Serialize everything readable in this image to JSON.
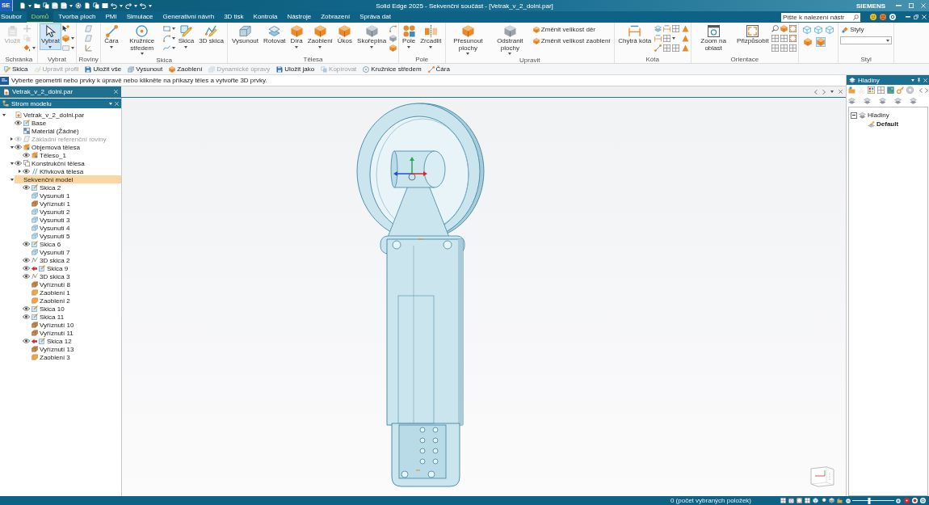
{
  "title_bar": {
    "app_badge": "SE",
    "title": "Solid Edge 2025 - Sekvenční součást - [Vetrak_v_2_dolni.par]",
    "brand": "SIEMENS"
  },
  "menu_tabs": [
    {
      "label": "Soubor",
      "selected": false
    },
    {
      "label": "Domů",
      "selected": true
    },
    {
      "label": "Tvorba ploch",
      "selected": false
    },
    {
      "label": "PMI",
      "selected": false
    },
    {
      "label": "Simulace",
      "selected": false
    },
    {
      "label": "Generativní návrh",
      "selected": false
    },
    {
      "label": "3D tisk",
      "selected": false
    },
    {
      "label": "Kontrola",
      "selected": false
    },
    {
      "label": "Nástroje",
      "selected": false
    },
    {
      "label": "Zobrazení",
      "selected": false
    },
    {
      "label": "Správa dat",
      "selected": false
    }
  ],
  "search": {
    "placeholder": "Pište k nalezení nástr"
  },
  "ribbon": {
    "groups": [
      {
        "label": "Schránka",
        "buttons": [
          {
            "kind": "large",
            "label": "Vložit",
            "disabled": true,
            "active": false,
            "dropdown": false
          }
        ]
      },
      {
        "label": "Vybrat",
        "buttons": [
          {
            "kind": "large",
            "label": "Vybrat",
            "disabled": false,
            "active": true,
            "dropdown": true
          }
        ]
      },
      {
        "label": "Roviny"
      },
      {
        "label": "Skica",
        "buttons": [
          {
            "kind": "large",
            "label": "Čára",
            "disabled": false,
            "active": false,
            "dropdown": true
          },
          {
            "kind": "large",
            "label": "Kružnice středem",
            "disabled": false,
            "active": false,
            "dropdown": true
          },
          {
            "kind": "large",
            "label": "Skica",
            "disabled": false,
            "active": false,
            "dropdown": true
          },
          {
            "kind": "large",
            "label": "3D skica",
            "disabled": false,
            "active": false,
            "dropdown": false
          }
        ]
      },
      {
        "label": "Tělesa",
        "buttons": [
          {
            "kind": "large",
            "label": "Vysunout",
            "disabled": false,
            "active": false,
            "dropdown": false
          },
          {
            "kind": "large",
            "label": "Rotovat",
            "disabled": false,
            "active": false,
            "dropdown": false
          },
          {
            "kind": "large",
            "label": "Díra",
            "disabled": false,
            "active": false,
            "dropdown": true
          },
          {
            "kind": "large",
            "label": "Zaoblení",
            "disabled": false,
            "active": false,
            "dropdown": true
          },
          {
            "kind": "large",
            "label": "Úkos",
            "disabled": false,
            "active": false,
            "dropdown": false
          },
          {
            "kind": "large",
            "label": "Skořepina",
            "disabled": false,
            "active": false,
            "dropdown": true
          }
        ]
      },
      {
        "label": "Pole",
        "buttons": [
          {
            "kind": "large",
            "label": "Pole",
            "disabled": false,
            "active": false,
            "dropdown": true
          },
          {
            "kind": "large",
            "label": "Zrcadlit",
            "disabled": false,
            "active": false,
            "dropdown": true
          }
        ]
      },
      {
        "label": "Upravit",
        "buttons": [
          {
            "kind": "large",
            "label": "Přesunout plochy",
            "disabled": false,
            "active": false,
            "dropdown": true
          },
          {
            "kind": "large",
            "label": "Odstranit plochy",
            "disabled": false,
            "active": false,
            "dropdown": true
          },
          {
            "kind": "small",
            "label": "Změnit velikost děr",
            "disabled": false,
            "active": false,
            "dropdown": false
          },
          {
            "kind": "small",
            "label": "Změnit velikost zaoblení",
            "disabled": false,
            "active": false,
            "dropdown": false
          }
        ]
      },
      {
        "label": "Kóta",
        "buttons": [
          {
            "kind": "large",
            "label": "Chytrá kóta",
            "disabled": false,
            "active": false,
            "dropdown": false
          }
        ]
      },
      {
        "label": "Orientace",
        "buttons": [
          {
            "kind": "large",
            "label": "Zoom na oblast",
            "disabled": false,
            "active": false,
            "dropdown": false
          },
          {
            "kind": "large",
            "label": "Přizpůsobit",
            "disabled": false,
            "active": false,
            "dropdown": false
          }
        ]
      },
      {
        "shading": [
          {
            "selected": false
          },
          {
            "selected": true
          }
        ]
      },
      {
        "label": "Styl",
        "buttons": [
          {
            "kind": "small",
            "label": "Styly",
            "disabled": false,
            "active": false,
            "dropdown": false
          }
        ]
      }
    ]
  },
  "quick_toolbar": [
    {
      "label": "Skica",
      "disabled": false
    },
    {
      "label": "Upravit profil",
      "disabled": true
    },
    {
      "label": "Uložit vše",
      "disabled": false
    },
    {
      "label": "Vysunout",
      "disabled": false
    },
    {
      "label": "Zaoblení",
      "disabled": false
    },
    {
      "label": "Dynamické úpravy",
      "disabled": true
    },
    {
      "label": "Uložit jako",
      "disabled": false
    },
    {
      "label": "Kopírovat",
      "disabled": true
    },
    {
      "label": "Kružnice středem",
      "disabled": false
    },
    {
      "label": "Čára",
      "disabled": false
    }
  ],
  "prompt": {
    "text": "Vyberte geometrii nebo prvky k úpravě nebo klikněte na příkazy těles a vytvořte 3D prvky."
  },
  "document_tabs": [
    {
      "label": "Vetrak_v_2_dolni.par",
      "selected": true
    }
  ],
  "model_tree": {
    "title": "Strom modelu",
    "items": [
      {
        "label": "Vetrak_v_2_dolni.par",
        "kind": "part",
        "eye": false,
        "dimmed": false,
        "flagged": false,
        "selected": false,
        "expanded": true,
        "children": [
          {
            "label": "Base",
            "kind": "sketch",
            "eye": true,
            "dimmed": false,
            "flagged": false,
            "selected": false
          },
          {
            "label": "Materiál (Žádné)",
            "kind": "material",
            "eye": false,
            "dimmed": false,
            "flagged": false,
            "selected": false
          },
          {
            "label": "Základní referenční roviny",
            "kind": "planes",
            "eye": true,
            "dimmed": true,
            "flagged": false,
            "selected": false,
            "expanded": false
          },
          {
            "label": "Objemová tělesa",
            "kind": "body",
            "eye": true,
            "dimmed": false,
            "flagged": false,
            "selected": false,
            "expanded": true,
            "children": [
              {
                "label": "Těleso_1",
                "kind": "body",
                "eye": true,
                "dimmed": false,
                "flagged": false,
                "selected": false
              }
            ]
          },
          {
            "label": "Konstrukční tělesa",
            "kind": "construction",
            "eye": true,
            "dimmed": false,
            "flagged": false,
            "selected": false,
            "expanded": true,
            "children": [
              {
                "label": "Křivková tělesa",
                "kind": "curves",
                "eye": true,
                "dimmed": false,
                "flagged": false,
                "selected": false,
                "expanded": false
              }
            ]
          },
          {
            "label": "Sekvenční model",
            "kind": "model",
            "eye": false,
            "dimmed": false,
            "flagged": false,
            "selected": true,
            "expanded": true,
            "children": [
              {
                "label": "Skica 2",
                "kind": "sketch",
                "eye": true,
                "dimmed": false,
                "flagged": false,
                "selected": false
              },
              {
                "label": "Vysunutí 1",
                "kind": "extrude",
                "eye": false,
                "dimmed": false,
                "flagged": false,
                "selected": false
              },
              {
                "label": "Vyříznutí 1",
                "kind": "cut",
                "eye": false,
                "dimmed": false,
                "flagged": false,
                "selected": false
              },
              {
                "label": "Vysunutí 2",
                "kind": "extrude",
                "eye": false,
                "dimmed": false,
                "flagged": false,
                "selected": false
              },
              {
                "label": "Vysunutí 3",
                "kind": "extrude",
                "eye": false,
                "dimmed": false,
                "flagged": false,
                "selected": false
              },
              {
                "label": "Vysunutí 4",
                "kind": "extrude",
                "eye": false,
                "dimmed": false,
                "flagged": false,
                "selected": false
              },
              {
                "label": "Vysunutí 5",
                "kind": "extrude",
                "eye": false,
                "dimmed": false,
                "flagged": false,
                "selected": false
              },
              {
                "label": "Skica 6",
                "kind": "sketch",
                "eye": true,
                "dimmed": false,
                "flagged": false,
                "selected": false
              },
              {
                "label": "Vysunutí 7",
                "kind": "extrude",
                "eye": false,
                "dimmed": false,
                "flagged": false,
                "selected": false
              },
              {
                "label": "3D skica 2",
                "kind": "sketch3d",
                "eye": true,
                "dimmed": false,
                "flagged": false,
                "selected": false
              },
              {
                "label": "Skica 9",
                "kind": "sketch",
                "eye": true,
                "dimmed": false,
                "flagged": true,
                "selected": false
              },
              {
                "label": "3D skica 3",
                "kind": "sketch3d",
                "eye": true,
                "dimmed": false,
                "flagged": false,
                "selected": false
              },
              {
                "label": "Vyříznutí 8",
                "kind": "cut",
                "eye": false,
                "dimmed": false,
                "flagged": false,
                "selected": false
              },
              {
                "label": "Zaoblení 1",
                "kind": "round",
                "eye": false,
                "dimmed": false,
                "flagged": false,
                "selected": false
              },
              {
                "label": "Zaoblení 2",
                "kind": "round",
                "eye": false,
                "dimmed": false,
                "flagged": false,
                "selected": false
              },
              {
                "label": "Skica 10",
                "kind": "sketch",
                "eye": true,
                "dimmed": false,
                "flagged": false,
                "selected": false
              },
              {
                "label": "Skica 11",
                "kind": "sketch",
                "eye": true,
                "dimmed": false,
                "flagged": false,
                "selected": false
              },
              {
                "label": "Vyříznutí 10",
                "kind": "cut",
                "eye": false,
                "dimmed": false,
                "flagged": false,
                "selected": false
              },
              {
                "label": "Vyříznutí 11",
                "kind": "cut",
                "eye": false,
                "dimmed": false,
                "flagged": false,
                "selected": false
              },
              {
                "label": "Skica 12",
                "kind": "sketch",
                "eye": true,
                "dimmed": false,
                "flagged": true,
                "selected": false
              },
              {
                "label": "Vyříznutí 13",
                "kind": "cut",
                "eye": false,
                "dimmed": false,
                "flagged": false,
                "selected": false
              },
              {
                "label": "Zaoblení 3",
                "kind": "round",
                "eye": false,
                "dimmed": false,
                "flagged": false,
                "selected": false
              }
            ]
          }
        ]
      }
    ]
  },
  "layers_panel": {
    "title": "Hladiny",
    "tree": [
      {
        "label": "Hladiny",
        "active": false,
        "expanded": true,
        "children": [
          {
            "label": "Default",
            "active": true
          }
        ]
      }
    ]
  },
  "status_bar": {
    "text": "0 (počet vybraných položek)",
    "zoom_slider": {
      "level": 0.4
    }
  }
}
